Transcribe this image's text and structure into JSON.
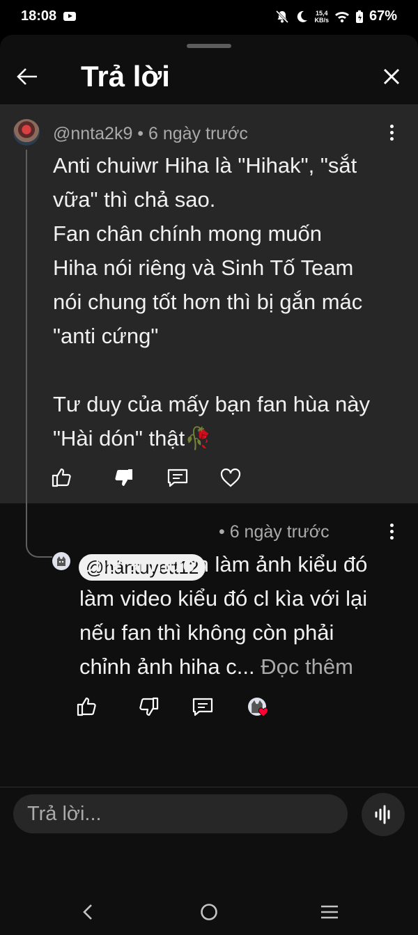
{
  "status_bar": {
    "time": "18:08",
    "net_speed_value": "15,4",
    "net_speed_unit": "KB/s",
    "battery": "67%"
  },
  "header": {
    "title": "Trả lời"
  },
  "parent_comment": {
    "author": "@nnta2k9",
    "time": "6 ngày trước",
    "text": "Anti chuiwr Hiha là \"Hihak\", \"sắt\nvữa\" thì chả sao.\nFan chân chính mong muốn\nHiha nói riêng và Sinh Tố Team\nnói chung tốt hơn thì bị gắn mác\n\"anti cứng\"\n\nTư duy của mấy bạn fan hùa này\n\"Hài dón\" thật🥀"
  },
  "reply": {
    "author": "@hântuyett12",
    "time": "6 ngày trước",
    "text": "Chứ ai mượn làm ảnh kiểu đó\nlàm video kiểu đó cl kìa với lại\nnếu fan thì không còn phải\nchỉnh ảnh hiha c...",
    "read_more": "Đọc thêm"
  },
  "reply_input": {
    "placeholder": "Trả lời..."
  },
  "colors": {
    "sheet_bg": "#0f0f0f",
    "highlight_bg": "#272727",
    "secondary_text": "#aaaaaa",
    "heart": "#ff0033"
  }
}
